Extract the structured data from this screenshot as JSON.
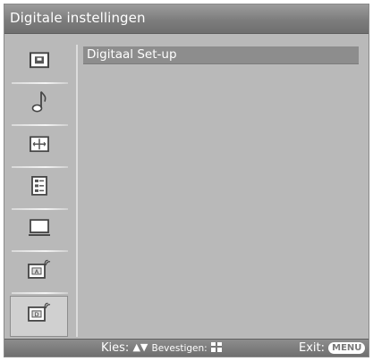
{
  "header": {
    "title": "Digitale instellingen"
  },
  "sidebar": {
    "items": [
      {
        "icon": "picture-icon"
      },
      {
        "icon": "music-note-icon"
      },
      {
        "icon": "screen-adjust-icon"
      },
      {
        "icon": "setup-list-icon"
      },
      {
        "icon": "monitor-icon"
      },
      {
        "icon": "analog-settings-icon"
      },
      {
        "icon": "digital-settings-icon",
        "selected": true
      }
    ]
  },
  "main": {
    "items": [
      {
        "label": "Digitaal Set-up",
        "highlighted": true
      }
    ]
  },
  "footer": {
    "select_label": "Kies:",
    "confirm_label": "Bevestigen:",
    "exit_label": "Exit:",
    "exit_key": "MENU"
  },
  "colors": {
    "background": "#b9b9b9",
    "title_bar": "#7d7d7d",
    "highlight_row": "#8d8d8d",
    "text": "#ffffff"
  }
}
